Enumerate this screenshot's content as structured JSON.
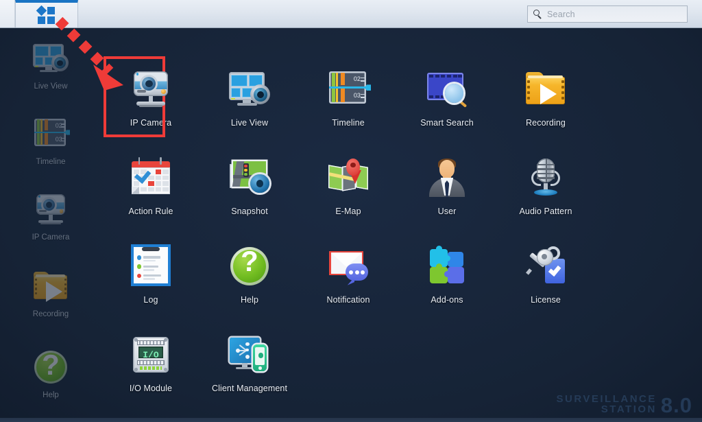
{
  "window": {
    "app_tab_icon": "grid-squares-icon",
    "search": {
      "placeholder": "Search",
      "value": "",
      "icon": "search-icon"
    }
  },
  "sidebar": {
    "items": [
      {
        "label": "Live View",
        "icon": "live-view-icon"
      },
      {
        "label": "Timeline",
        "icon": "timeline-icon"
      },
      {
        "label": "IP Camera",
        "icon": "ip-camera-icon"
      },
      {
        "label": "Recording",
        "icon": "recording-icon"
      },
      {
        "label": "Help",
        "icon": "help-icon"
      }
    ]
  },
  "main": {
    "apps": [
      {
        "label": "IP Camera",
        "icon": "ip-camera-icon",
        "selected": true
      },
      {
        "label": "Live View",
        "icon": "live-view-icon",
        "selected": false
      },
      {
        "label": "Timeline",
        "icon": "timeline-icon",
        "selected": false
      },
      {
        "label": "Smart Search",
        "icon": "smart-search-icon",
        "selected": false
      },
      {
        "label": "Recording",
        "icon": "recording-icon",
        "selected": false
      },
      {
        "label": "Action Rule",
        "icon": "action-rule-icon",
        "selected": false
      },
      {
        "label": "Snapshot",
        "icon": "snapshot-icon",
        "selected": false
      },
      {
        "label": "E-Map",
        "icon": "e-map-icon",
        "selected": false
      },
      {
        "label": "User",
        "icon": "user-icon",
        "selected": false
      },
      {
        "label": "Audio Pattern",
        "icon": "audio-pattern-icon",
        "selected": false
      },
      {
        "label": "Log",
        "icon": "log-icon",
        "selected": false
      },
      {
        "label": "Help",
        "icon": "help-icon",
        "selected": false
      },
      {
        "label": "Notification",
        "icon": "notification-icon",
        "selected": false
      },
      {
        "label": "Add-ons",
        "icon": "add-ons-icon",
        "selected": false
      },
      {
        "label": "License",
        "icon": "license-icon",
        "selected": false
      },
      {
        "label": "I/O Module",
        "icon": "io-module-icon",
        "selected": false
      },
      {
        "label": "Client Management",
        "icon": "client-management-icon",
        "selected": false
      }
    ]
  },
  "icon_text": {
    "timeline_hour_1": "02",
    "timeline_hour_2": "03",
    "io_module_label": "I/O",
    "help_glyph": "?"
  },
  "annotation": {
    "type": "dashed-arrow",
    "color": "#ef3b38",
    "points_to": "IP Camera",
    "highlight_box_color": "#ef3b38"
  },
  "watermark": {
    "line1": "SURVEILLANCE",
    "line2": "STATION",
    "version": "8.0"
  },
  "colors": {
    "desktop_bg": "#172438",
    "topbar_bg": "#dfe6ef",
    "accent_blue": "#1c76c8",
    "annotation_red": "#ef3b38"
  }
}
